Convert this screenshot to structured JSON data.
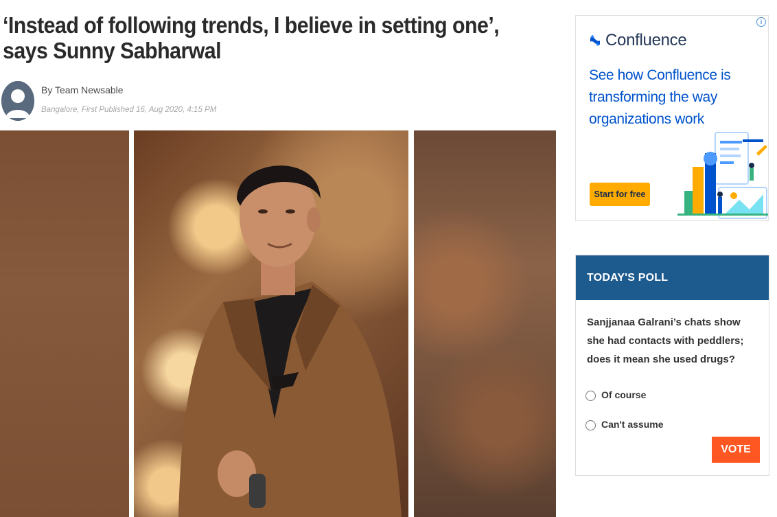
{
  "article": {
    "headline": "‘Instead of following trends, I believe in setting one’, says Sunny Sabharwal",
    "author": "By Team Newsable",
    "published": "Bangalore, First Published 16, Aug 2020, 4:15 PM",
    "author_avatar_icon": "user-avatar-icon",
    "hero_image_icon": "person-photo"
  },
  "ad": {
    "info_label": "i",
    "brand_icon": "confluence-logo-icon",
    "brand_name": "Confluence",
    "headline": "See how Confluence is transforming the way organizations work",
    "cta_label": "Start for free",
    "colors": {
      "brand": "#0052cc",
      "cta": "#ffab00"
    }
  },
  "poll": {
    "header": "TODAY'S POLL",
    "question": "Sanjjanaa Galrani’s chats show she had contacts with peddlers; does it mean she used drugs?",
    "options": [
      {
        "label": "Of course",
        "selected": false
      },
      {
        "label": "Can't assume",
        "selected": false
      }
    ],
    "vote_label": "VOTE",
    "colors": {
      "header_bg": "#1d5a8e",
      "vote_bg": "#ff5722"
    }
  }
}
